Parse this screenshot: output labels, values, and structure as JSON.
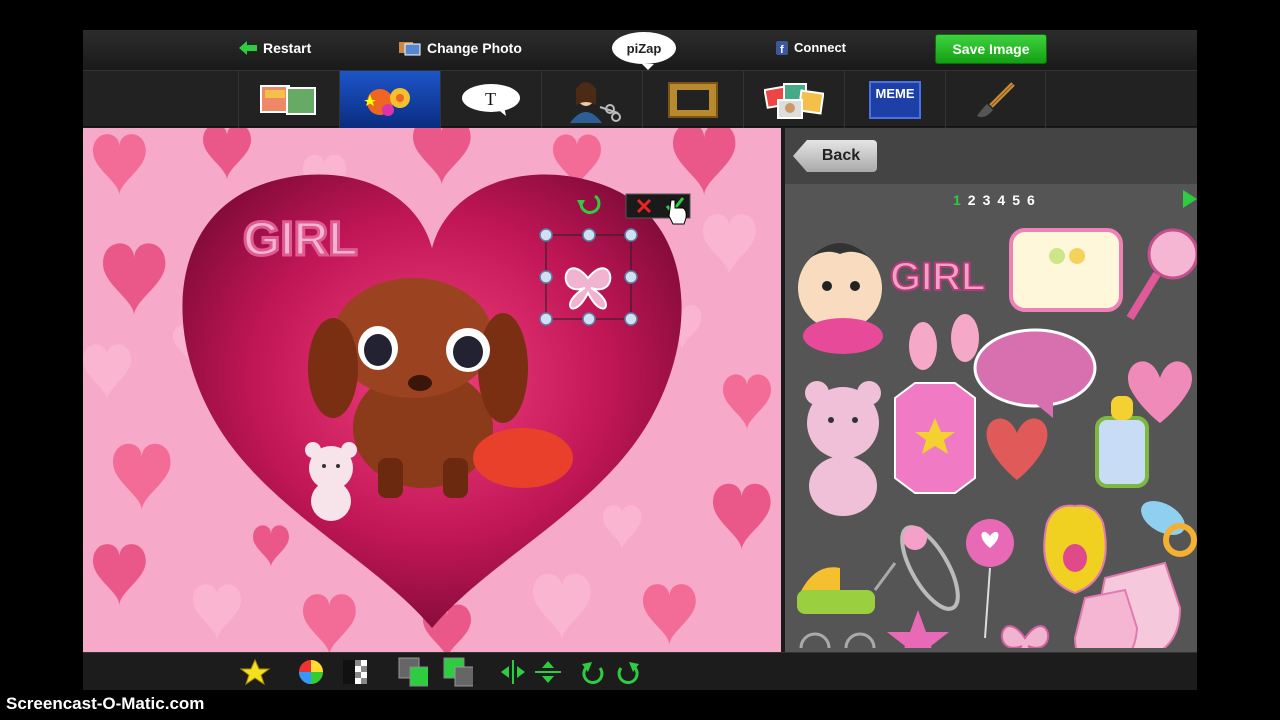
{
  "topbar": {
    "restart_label": "Restart",
    "change_photo_label": "Change Photo",
    "logo_text": "piZap",
    "connect_label": "Connect",
    "save_label": "Save Image"
  },
  "toolbar": {
    "meme_label": "MEME",
    "text_tool_label": "T"
  },
  "canvas": {
    "girl_text": "GIRL"
  },
  "panel": {
    "back_label": "Back",
    "pages": [
      "1",
      "2",
      "3",
      "4",
      "5",
      "6"
    ],
    "active_page": "1",
    "girl_sticker_text": "GIRL"
  },
  "colors": {
    "accent_green": "#2ecc40",
    "active_tool": "#1d55c9",
    "canvas_pink": "#f7a9c9",
    "heart_dark": "#b0114f"
  },
  "watermark": "Screencast-O-Matic.com"
}
